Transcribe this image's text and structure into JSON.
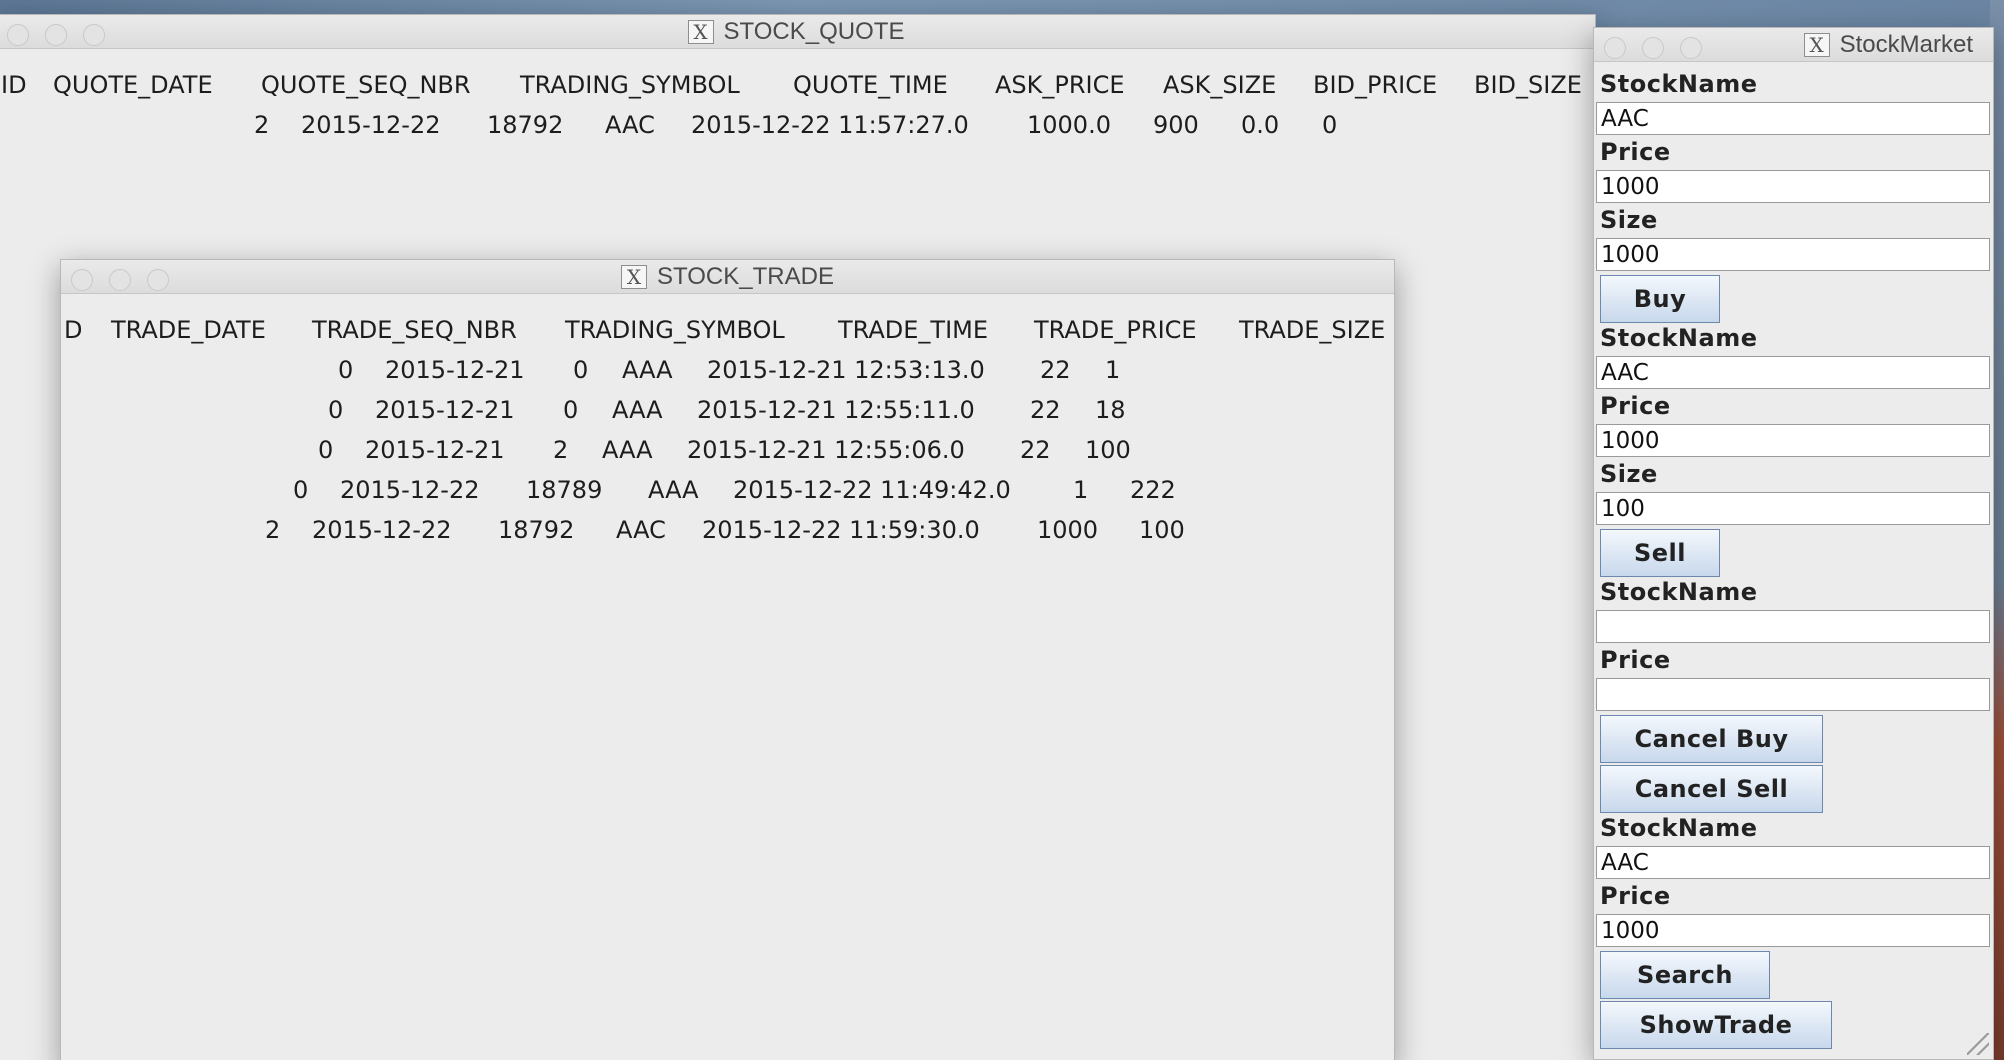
{
  "stock_quote": {
    "title": "STOCK_QUOTE",
    "columns": [
      "ID",
      "QUOTE_DATE",
      "QUOTE_SEQ_NBR",
      "TRADING_SYMBOL",
      "QUOTE_TIME",
      "ASK_PRICE",
      "ASK_SIZE",
      "BID_PRICE",
      "BID_SIZE"
    ],
    "rows": [
      [
        "2",
        "2015-12-22",
        "18792",
        "AAC",
        "2015-12-22 11:57:27.0",
        "1000.0",
        "900",
        "0.0",
        "0"
      ]
    ]
  },
  "stock_trade": {
    "title": "STOCK_TRADE",
    "columns": [
      "D",
      "TRADE_DATE",
      "TRADE_SEQ_NBR",
      "TRADING_SYMBOL",
      "TRADE_TIME",
      "TRADE_PRICE",
      "TRADE_SIZE"
    ],
    "rows": [
      [
        "0",
        "2015-12-21",
        "0",
        "AAA",
        "2015-12-21 12:53:13.0",
        "22",
        "1"
      ],
      [
        "0",
        "2015-12-21",
        "0",
        "AAA",
        "2015-12-21 12:55:11.0",
        "22",
        "18"
      ],
      [
        "0",
        "2015-12-21",
        "2",
        "AAA",
        "2015-12-21 12:55:06.0",
        "22",
        "100"
      ],
      [
        "0",
        "2015-12-22",
        "18789",
        "AAA",
        "2015-12-22 11:49:42.0",
        "1",
        "222"
      ],
      [
        "2",
        "2015-12-22",
        "18792",
        "AAC",
        "2015-12-22 11:59:30.0",
        "1000",
        "100"
      ]
    ]
  },
  "stock_market": {
    "title": "StockMarket",
    "buy": {
      "name_label": "StockName",
      "name_value": "AAC",
      "price_label": "Price",
      "price_value": "1000",
      "size_label": "Size",
      "size_value": "1000",
      "button": "Buy"
    },
    "sell": {
      "name_label": "StockName",
      "name_value": "AAC",
      "price_label": "Price",
      "price_value": "1000",
      "size_label": "Size",
      "size_value": "100",
      "button": "Sell"
    },
    "cancel": {
      "name_label": "StockName",
      "name_value": "",
      "price_label": "Price",
      "price_value": "",
      "cancel_buy_button": "Cancel Buy",
      "cancel_sell_button": "Cancel Sell"
    },
    "search": {
      "name_label": "StockName",
      "name_value": "AAC",
      "price_label": "Price",
      "price_value": "1000",
      "search_button": "Search",
      "show_trade_button": "ShowTrade"
    }
  },
  "icons": {
    "window_app_icon": "x11-icon"
  }
}
